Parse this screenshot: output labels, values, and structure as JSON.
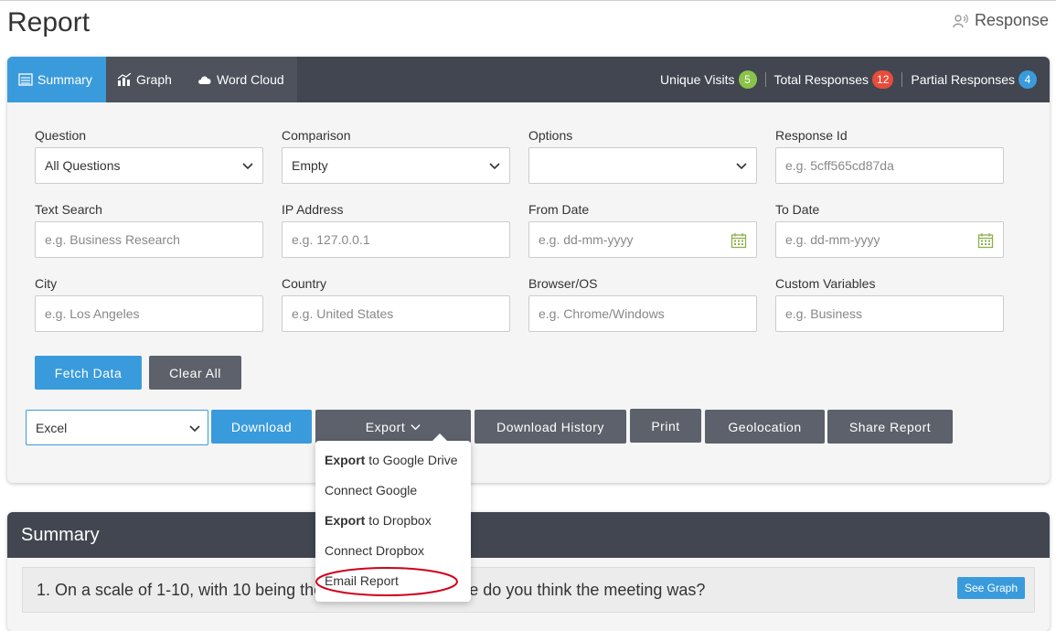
{
  "page": {
    "title": "Report",
    "response_link": "Response"
  },
  "tabs": [
    {
      "label": "Summary",
      "icon": "list-icon"
    },
    {
      "label": "Graph",
      "icon": "bar-chart-icon"
    },
    {
      "label": "Word Cloud",
      "icon": "cloud-icon"
    }
  ],
  "stats": {
    "unique_visits": {
      "label": "Unique Visits",
      "value": "5",
      "color": "#8bc34a"
    },
    "total_responses": {
      "label": "Total Responses",
      "value": "12",
      "color": "#e74c3c"
    },
    "partial_responses": {
      "label": "Partial Responses",
      "value": "4",
      "color": "#3a9bdc"
    }
  },
  "filters": {
    "question": {
      "label": "Question",
      "value": "All Questions"
    },
    "comparison": {
      "label": "Comparison",
      "value": "Empty"
    },
    "options": {
      "label": "Options",
      "value": ""
    },
    "response_id": {
      "label": "Response Id",
      "placeholder": "e.g. 5cff565cd87da"
    },
    "text_search": {
      "label": "Text Search",
      "placeholder": "e.g. Business Research"
    },
    "ip_address": {
      "label": "IP Address",
      "placeholder": "e.g. 127.0.0.1"
    },
    "from_date": {
      "label": "From Date",
      "placeholder": "e.g. dd-mm-yyyy"
    },
    "to_date": {
      "label": "To Date",
      "placeholder": "e.g. dd-mm-yyyy"
    },
    "city": {
      "label": "City",
      "placeholder": "e.g. Los Angeles"
    },
    "country": {
      "label": "Country",
      "placeholder": "e.g. United States"
    },
    "browser_os": {
      "label": "Browser/OS",
      "placeholder": "e.g. Chrome/Windows"
    },
    "custom_variables": {
      "label": "Custom Variables",
      "placeholder": "e.g. Business"
    }
  },
  "actions": {
    "fetch_data": "Fetch Data",
    "clear_all": "Clear All",
    "format_select": "Excel",
    "download": "Download",
    "export": "Export",
    "download_history": "Download History",
    "print": "Print",
    "geolocation": "Geolocation",
    "share_report": "Share Report"
  },
  "export_menu": [
    {
      "bold": "Export",
      "rest": " to Google Drive"
    },
    {
      "bold": "",
      "rest": "Connect Google"
    },
    {
      "bold": "Export",
      "rest": " to Dropbox"
    },
    {
      "bold": "",
      "rest": "Connect Dropbox"
    },
    {
      "bold": "",
      "rest": "Email Report"
    }
  ],
  "summary": {
    "title": "Summary",
    "question": "1. On a scale of 1-10, with 10 being the best, how productive do you think the meeting was?",
    "see_graph": "See Graph"
  },
  "colors": {
    "accent": "#3a9bdc",
    "header": "#414650",
    "button_gray": "#5d616b",
    "highlight": "#d0021b"
  }
}
